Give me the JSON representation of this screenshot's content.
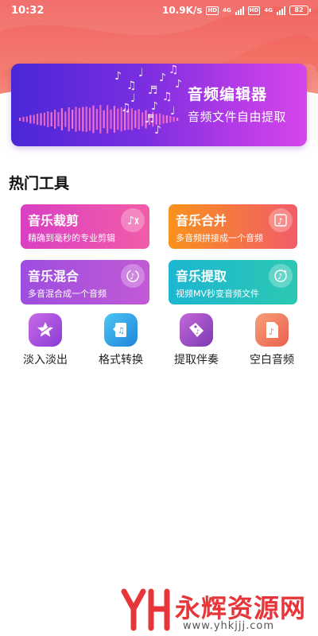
{
  "status_bar": {
    "time": "10:32",
    "speed": "10.9K/s",
    "hd1": "HD",
    "net1": "4G",
    "hd2": "HD",
    "net2": "4G",
    "battery": "82"
  },
  "banner": {
    "title": "音频编辑器",
    "subtitle": "音频文件自由提取"
  },
  "section_title": "热门工具",
  "cards": [
    {
      "title": "音乐裁剪",
      "desc": "精确到毫秒的专业剪辑",
      "icon": "music-cut-icon"
    },
    {
      "title": "音乐合并",
      "desc": "多音频拼接成一个音频",
      "icon": "music-merge-icon"
    },
    {
      "title": "音乐混合",
      "desc": "多音混合成一个音频",
      "icon": "music-mix-icon"
    },
    {
      "title": "音乐提取",
      "desc": "视频MV秒变音频文件",
      "icon": "music-extract-icon"
    }
  ],
  "tools": [
    {
      "label": "淡入淡出",
      "icon": "fade-icon"
    },
    {
      "label": "格式转换",
      "icon": "format-convert-icon"
    },
    {
      "label": "提取伴奏",
      "icon": "accompaniment-icon"
    },
    {
      "label": "空白音频",
      "icon": "blank-audio-icon"
    }
  ],
  "watermark": {
    "text": "永辉资源网",
    "url": "www.yhkjjj.com"
  },
  "colors": {
    "header": "#f05a56",
    "banner_start": "#4a27d6",
    "banner_end": "#d646ea",
    "watermark": "#e6363a"
  }
}
